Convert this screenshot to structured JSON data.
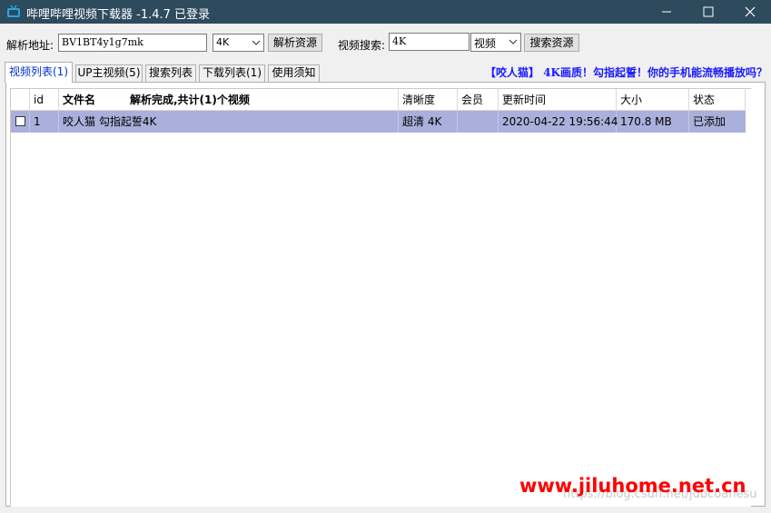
{
  "window": {
    "title": "哔哩哔哩视频下载器 -1.4.7  已登录",
    "icon": "tv-icon",
    "controls": [
      "minimize-icon",
      "maximize-icon",
      "close-icon"
    ]
  },
  "toolbar": {
    "parse_label": "解析地址:",
    "parse_value": "BV1BT4y1g7mk",
    "quality_value": "4K",
    "parse_button": "解析资源",
    "search_label": "视频搜索:",
    "search_value": "4K",
    "search_type_value": "视频",
    "search_button": "搜索资源"
  },
  "tabs": [
    {
      "label": "视频列表(1)",
      "active": true
    },
    {
      "label": "UP主视频(5)",
      "active": false
    },
    {
      "label": "搜索列表",
      "active": false
    },
    {
      "label": "下载列表(1)",
      "active": false
    },
    {
      "label": "使用须知",
      "active": false
    }
  ],
  "notice": "【咬人猫】 4K画质！勾指起誓！你的手机能流畅播放吗？",
  "table": {
    "columns": [
      "",
      "id",
      "文件名",
      "清晰度",
      "会员",
      "更新时间",
      "大小",
      "状态"
    ],
    "parse_status": "解析完成,共计(1)个视频",
    "rows": [
      {
        "checked": false,
        "id": "1",
        "filename": "咬人猫 勾指起誓4K",
        "quality": "超清 4K",
        "vip": "",
        "updated": "2020-04-22 19:56:44",
        "size": "170.8 MB",
        "status": "已添加"
      }
    ]
  },
  "watermarks": {
    "faint": "https://blog.csdn.net/jdbcoanesu",
    "main": "www.jiluhome.net.cn"
  },
  "colors": {
    "titlebar": "#2e4a5d",
    "selected_row": "#aab0dc",
    "notice_text": "#1a1aff",
    "active_tab_text": "#0033cc",
    "watermark": "#ff0000"
  }
}
